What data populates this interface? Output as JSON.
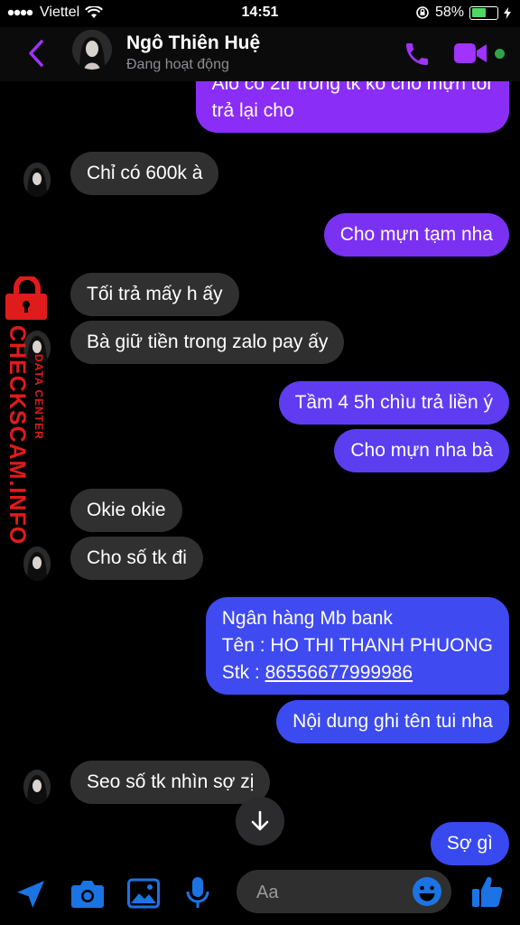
{
  "status_bar": {
    "carrier": "Viettel",
    "time": "14:51",
    "battery": "58%",
    "battery_level": 0.58
  },
  "header": {
    "name": "Ngô Thiên Huệ",
    "status": "Đang hoạt động"
  },
  "watermark": {
    "main": "CHECKSCAM.INFO",
    "sub": "DATA CENTER"
  },
  "messages": [
    {
      "side": "out",
      "lines": [
        "Alo có 2tr trong tk ko cho mựn tôi",
        "trả lại cho"
      ]
    },
    {
      "side": "in",
      "lines": [
        "Chỉ có 600k à"
      ]
    },
    {
      "side": "out",
      "lines": [
        "Cho mựn tạm nha"
      ]
    },
    {
      "side": "in",
      "lines": [
        "Tối trả mấy h ấy"
      ]
    },
    {
      "side": "in",
      "lines": [
        "Bà giữ tiền trong zalo pay ấy"
      ]
    },
    {
      "side": "out",
      "lines": [
        "Tầm 4 5h chìu trả liền ý"
      ]
    },
    {
      "side": "out",
      "lines": [
        "Cho mựn nha bà"
      ]
    },
    {
      "side": "in",
      "lines": [
        "Okie okie"
      ]
    },
    {
      "side": "in",
      "lines": [
        "Cho số tk đi"
      ]
    },
    {
      "side": "out",
      "lines": [
        "Ngân hàng Mb bank",
        "Tên : HO THI THANH PHUONG",
        "Stk : ",
        "86556677999986"
      ]
    },
    {
      "side": "out",
      "lines": [
        "Nội dung ghi tên tui nha"
      ]
    },
    {
      "side": "in",
      "lines": [
        "Seo số tk nhìn sợ zị"
      ]
    },
    {
      "side": "out",
      "lines": [
        "Sợ gì"
      ]
    }
  ],
  "composer": {
    "placeholder": "Aa"
  },
  "colors": {
    "accent": "#a033ff",
    "out_top": "#8b2cf5",
    "out_bottom": "#3a4cf0",
    "incoming": "#303030",
    "icon_blue": "#1b74e4"
  },
  "icons": [
    "back-icon",
    "phone-icon",
    "video-icon",
    "send-location-icon",
    "camera-icon",
    "gallery-icon",
    "mic-icon",
    "emoji-icon",
    "like-icon",
    "scroll-down-icon",
    "lock-icon"
  ]
}
